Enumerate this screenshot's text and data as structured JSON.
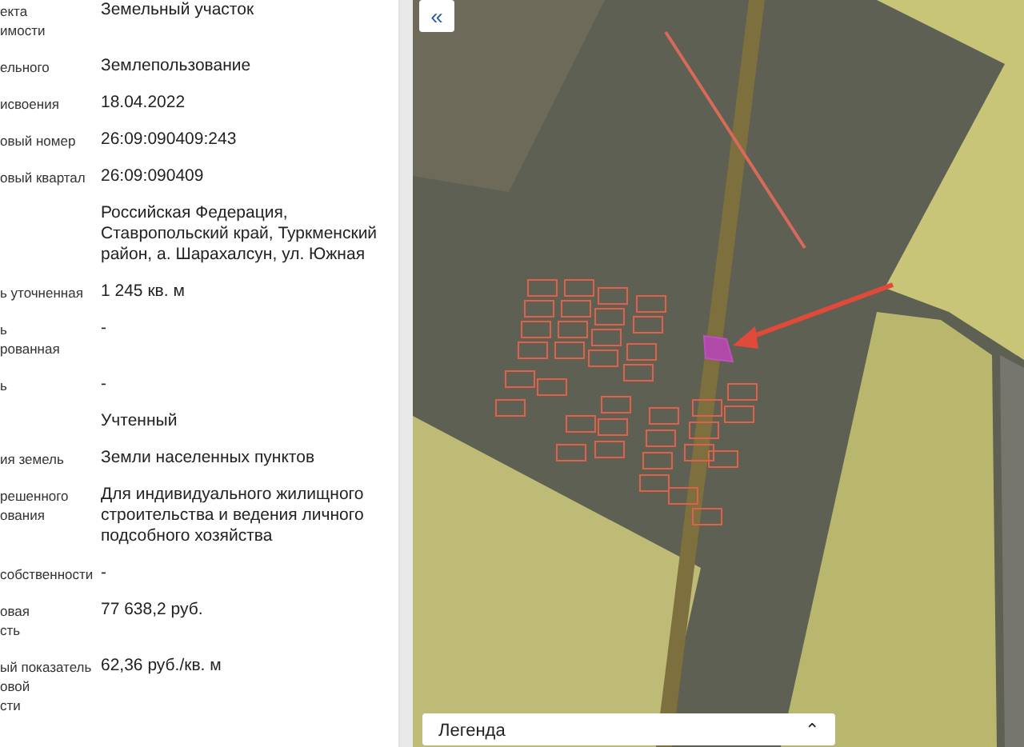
{
  "properties": [
    {
      "label": [
        "екта",
        "имости"
      ],
      "value": [
        "Земельный участок"
      ]
    },
    {
      "label": [
        "ельного"
      ],
      "value": [
        "Землепользование"
      ]
    },
    {
      "label": [
        "исвоения"
      ],
      "value": [
        "18.04.2022"
      ]
    },
    {
      "label": [
        "овый номер"
      ],
      "value": [
        "26:09:090409:243"
      ]
    },
    {
      "label": [
        "овый квартал"
      ],
      "value": [
        "26:09:090409"
      ]
    },
    {
      "value": [
        "Российская Федерация,",
        "Ставропольский край, Туркменский",
        "район, а. Шарахалсун, ул. Южная"
      ]
    },
    {
      "label": [
        "ь уточненная"
      ],
      "value": [
        "1 245 кв. м"
      ]
    },
    {
      "label": [
        "ь",
        "рованная"
      ],
      "value": [
        "-"
      ]
    },
    {
      "label": [
        "ь"
      ],
      "value": [
        "-"
      ]
    },
    {
      "value": [
        "Учтенный"
      ]
    },
    {
      "label": [
        "ия земель"
      ],
      "value": [
        "Земли населенных пунктов"
      ]
    },
    {
      "label": [
        "решенного",
        "ования"
      ],
      "value": [
        "Для индивидуального жилищного",
        "строительства и ведения личного",
        "подсобного хозяйства"
      ]
    },
    {
      "label": [
        "собственности"
      ],
      "value": [
        "-"
      ]
    },
    {
      "label": [
        "овая",
        "сть"
      ],
      "value": [
        "77 638,2 руб."
      ]
    },
    {
      "label": [
        "ый показатель",
        "овой",
        "сти"
      ],
      "value": [
        "62,36 руб./кв. м"
      ]
    }
  ],
  "map": {
    "collapse_button": "«",
    "legend": {
      "title": "Легенда",
      "toggle": "⌃"
    }
  }
}
